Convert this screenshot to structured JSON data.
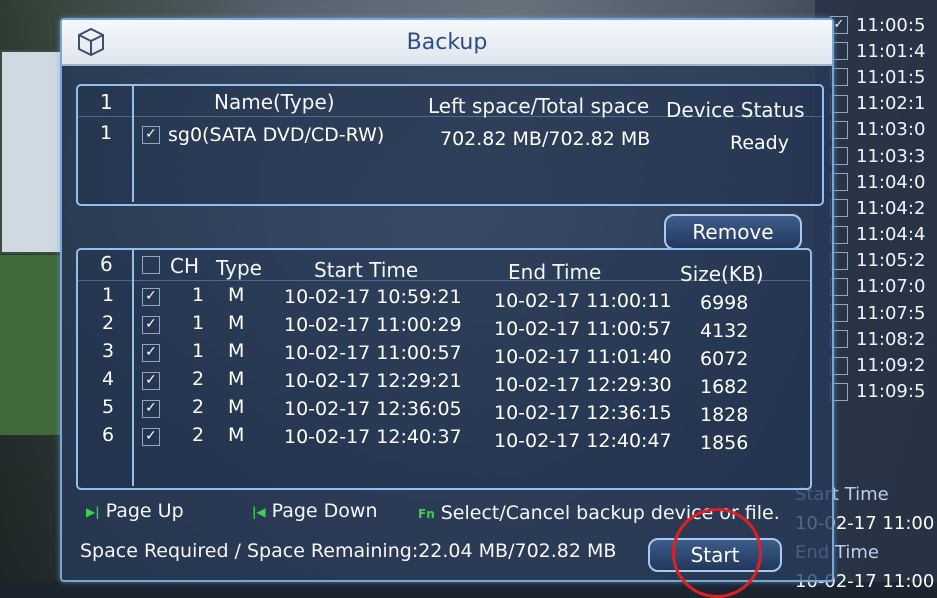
{
  "dialog": {
    "title": "Backup",
    "device_table": {
      "count": "1",
      "headers": {
        "name": "Name(Type)",
        "space": "Left space/Total space",
        "status": "Device Status"
      },
      "rows": [
        {
          "index": "1",
          "checked": true,
          "name": "sg0(SATA DVD/CD-RW)",
          "space": "702.82 MB/702.82 MB",
          "status": "Ready"
        }
      ]
    },
    "remove_label": "Remove",
    "file_table": {
      "count": "6",
      "headers": {
        "ch": "CH",
        "type": "Type",
        "start": "Start Time",
        "end": "End Time",
        "size": "Size(KB)"
      },
      "rows": [
        {
          "index": "1",
          "checked": true,
          "ch": "1",
          "type": "M",
          "start": "10-02-17 10:59:21",
          "end": "10-02-17 11:00:11",
          "size": "6998"
        },
        {
          "index": "2",
          "checked": true,
          "ch": "1",
          "type": "M",
          "start": "10-02-17 11:00:29",
          "end": "10-02-17 11:00:57",
          "size": "4132"
        },
        {
          "index": "3",
          "checked": true,
          "ch": "1",
          "type": "M",
          "start": "10-02-17 11:00:57",
          "end": "10-02-17 11:01:40",
          "size": "6072"
        },
        {
          "index": "4",
          "checked": true,
          "ch": "2",
          "type": "M",
          "start": "10-02-17 12:29:21",
          "end": "10-02-17 12:29:30",
          "size": "1682"
        },
        {
          "index": "5",
          "checked": true,
          "ch": "2",
          "type": "M",
          "start": "10-02-17 12:36:05",
          "end": "10-02-17 12:36:15",
          "size": "1828"
        },
        {
          "index": "6",
          "checked": true,
          "ch": "2",
          "type": "M",
          "start": "10-02-17 12:40:37",
          "end": "10-02-17 12:40:47",
          "size": "1856"
        }
      ]
    },
    "help": {
      "page_up": "Page Up",
      "page_down": "Page Down",
      "fn_icon": "Fn",
      "select_cancel": "Select/Cancel backup device or file."
    },
    "space_text": "Space Required / Space Remaining:22.04 MB/702.82 MB",
    "start_label": "Start"
  },
  "right_panel": {
    "times": [
      "11:00:5",
      "11:01:4",
      "11:01:5",
      "11:02:1",
      "11:03:0",
      "11:03:3",
      "11:04:0",
      "11:04:2",
      "11:04:4",
      "11:05:2",
      "11:07:0",
      "11:07:5",
      "11:08:2",
      "11:09:2",
      "11:09:5"
    ],
    "start_time_label": "Start Time",
    "start_time_value": "10-02-17 11:00",
    "end_time_label": "End Time",
    "end_time_value": "10-02-17 11:00"
  },
  "colors": {
    "accent": "#8ec0f0",
    "title_text": "#2c4d8a",
    "highlight_circle": "#e02020",
    "key_icon": "#3bd24a"
  }
}
